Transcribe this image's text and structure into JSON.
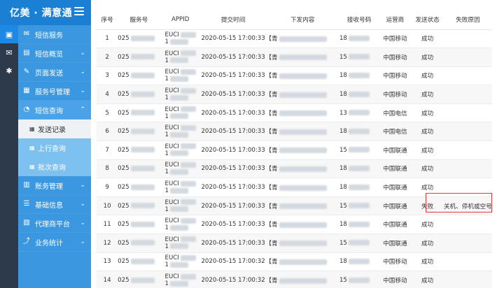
{
  "brand": {
    "title": "亿美 · 满意通"
  },
  "menu": {
    "items": [
      {
        "label": "短信服务",
        "icon": "message-icon",
        "chevron": ""
      },
      {
        "label": "短信概览",
        "icon": "chart-icon",
        "chevron": "⌄"
      },
      {
        "label": "页面发送",
        "icon": "edit-icon",
        "chevron": "⌄"
      },
      {
        "label": "服务号管理",
        "icon": "id-card-icon",
        "chevron": "⌄"
      },
      {
        "label": "短信查询",
        "icon": "chat-icon",
        "chevron": "⌃"
      }
    ],
    "sub": [
      {
        "label": "发送记录",
        "current": true
      },
      {
        "label": "上行查询",
        "current": false
      },
      {
        "label": "批次查询",
        "current": false
      }
    ],
    "items2": [
      {
        "label": "账务管理",
        "icon": "account-icon",
        "chevron": "⌄"
      },
      {
        "label": "基础信息",
        "icon": "info-icon",
        "chevron": "⌄"
      },
      {
        "label": "代理商平台",
        "icon": "agent-icon",
        "chevron": "⌄"
      },
      {
        "label": "业务统计",
        "icon": "stats-icon",
        "chevron": "⌄"
      }
    ]
  },
  "table": {
    "headers": [
      "序号",
      "服务号",
      "APPID",
      "提交时间",
      "下发内容",
      "接收号码",
      "运营商",
      "发送状态",
      "失败原因"
    ],
    "rows": [
      {
        "no": "1",
        "svc": "025",
        "appid_top": "EUCI",
        "appid_bot": "1",
        "time": "2020-05-15 17:00:33",
        "content": "【青",
        "phone": "18",
        "carrier": "中国移动",
        "status": "成功",
        "reason": ""
      },
      {
        "no": "2",
        "svc": "025",
        "appid_top": "EUCI",
        "appid_bot": "1",
        "time": "2020-05-15 17:00:33",
        "content": "【青",
        "phone": "15",
        "carrier": "中国移动",
        "status": "成功",
        "reason": ""
      },
      {
        "no": "3",
        "svc": "025",
        "appid_top": "EUCI",
        "appid_bot": "1",
        "time": "2020-05-15 17:00:33",
        "content": "【青",
        "phone": "18",
        "carrier": "中国移动",
        "status": "成功",
        "reason": ""
      },
      {
        "no": "4",
        "svc": "025",
        "appid_top": "EUCI",
        "appid_bot": "1",
        "time": "2020-05-15 17:00:33",
        "content": "【青",
        "phone": "18",
        "carrier": "中国移动",
        "status": "成功",
        "reason": ""
      },
      {
        "no": "5",
        "svc": "025",
        "appid_top": "EUCI",
        "appid_bot": "1",
        "time": "2020-05-15 17:00:33",
        "content": "【青",
        "phone": "13",
        "carrier": "中国电信",
        "status": "成功",
        "reason": ""
      },
      {
        "no": "6",
        "svc": "025",
        "appid_top": "EUCI",
        "appid_bot": "1",
        "time": "2020-05-15 17:00:33",
        "content": "【青",
        "phone": "18",
        "carrier": "中国电信",
        "status": "成功",
        "reason": ""
      },
      {
        "no": "7",
        "svc": "025",
        "appid_top": "EUCI",
        "appid_bot": "1",
        "time": "2020-05-15 17:00:33",
        "content": "【青",
        "phone": "15",
        "carrier": "中国联通",
        "status": "成功",
        "reason": ""
      },
      {
        "no": "8",
        "svc": "025",
        "appid_top": "EUCI",
        "appid_bot": "1",
        "time": "2020-05-15 17:00:33",
        "content": "【青",
        "phone": "18",
        "carrier": "中国联通",
        "status": "成功",
        "reason": ""
      },
      {
        "no": "9",
        "svc": "025",
        "appid_top": "EUCI",
        "appid_bot": "1",
        "time": "2020-05-15 17:00:33",
        "content": "【青",
        "phone": "18",
        "carrier": "中国联通",
        "status": "成功",
        "reason": ""
      },
      {
        "no": "10",
        "svc": "025",
        "appid_top": "EUCI",
        "appid_bot": "1",
        "time": "2020-05-15 17:00:33",
        "content": "【青",
        "phone": "15",
        "carrier": "中国联通",
        "status": "失败",
        "reason": "关机、停机或空号"
      },
      {
        "no": "11",
        "svc": "025",
        "appid_top": "EUCI",
        "appid_bot": "1",
        "time": "2020-05-15 17:00:33",
        "content": "【青",
        "phone": "18",
        "carrier": "中国联通",
        "status": "成功",
        "reason": ""
      },
      {
        "no": "12",
        "svc": "025",
        "appid_top": "EUCI",
        "appid_bot": "1",
        "time": "2020-05-15 17:00:33",
        "content": "【青",
        "phone": "15",
        "carrier": "中国联通",
        "status": "成功",
        "reason": ""
      },
      {
        "no": "13",
        "svc": "025",
        "appid_top": "EUCI",
        "appid_bot": "1",
        "time": "2020-05-15 17:00:32",
        "content": "【青",
        "phone": "18",
        "carrier": "中国移动",
        "status": "成功",
        "reason": ""
      },
      {
        "no": "14",
        "svc": "025",
        "appid_top": "EUCI",
        "appid_bot": "1",
        "time": "2020-05-15 17:00:32",
        "content": "【青",
        "phone": "15",
        "carrier": "中国移动",
        "status": "成功",
        "reason": ""
      }
    ]
  },
  "colors": {
    "brand": "#1b7fd3",
    "menu": "#3b97e0",
    "submenu": "#7cc1ef",
    "highlight": "#e53935"
  }
}
